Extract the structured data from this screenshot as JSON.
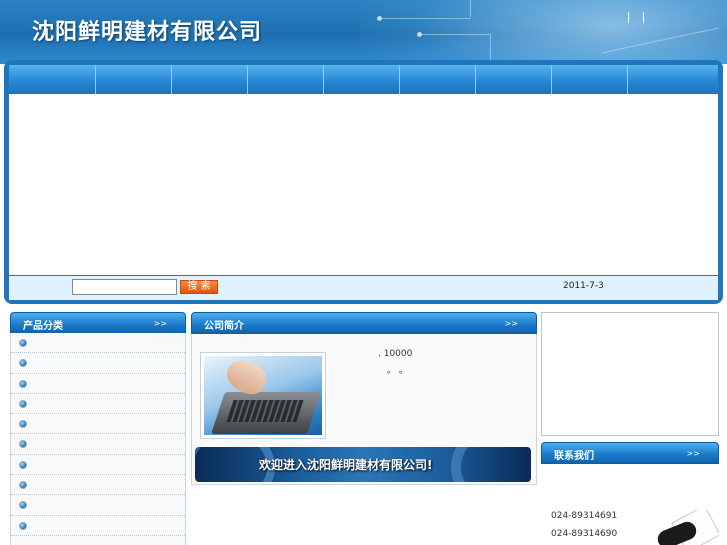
{
  "header": {
    "site_title": "沈阳鲜明建材有限公司"
  },
  "search": {
    "button_label": "搜 索",
    "input_value": ""
  },
  "date": "2011-7-3",
  "left_panel": {
    "title": "产品分类",
    "more": ">>"
  },
  "center_panel": {
    "title": "公司简介",
    "more": ">>",
    "intro_line1": ".                    10000",
    "intro_line2": "。  。",
    "welcome_text": "欢迎进入沈阳鲜明建材有限公司!"
  },
  "right_panel": {
    "title": "联系我们",
    "more": ">>",
    "phones": [
      "024-89314691",
      "024-89314690"
    ]
  },
  "colors": {
    "header_blue": "#1f6fb0",
    "frame_blue": "#1f76bc",
    "search_button_orange": "#e2530f",
    "search_bar_bg": "#dff2fd"
  },
  "icons": {
    "category_bullet": "bullet-icon",
    "image_intro": "laptop-image",
    "image_contact": "telephone-image"
  }
}
